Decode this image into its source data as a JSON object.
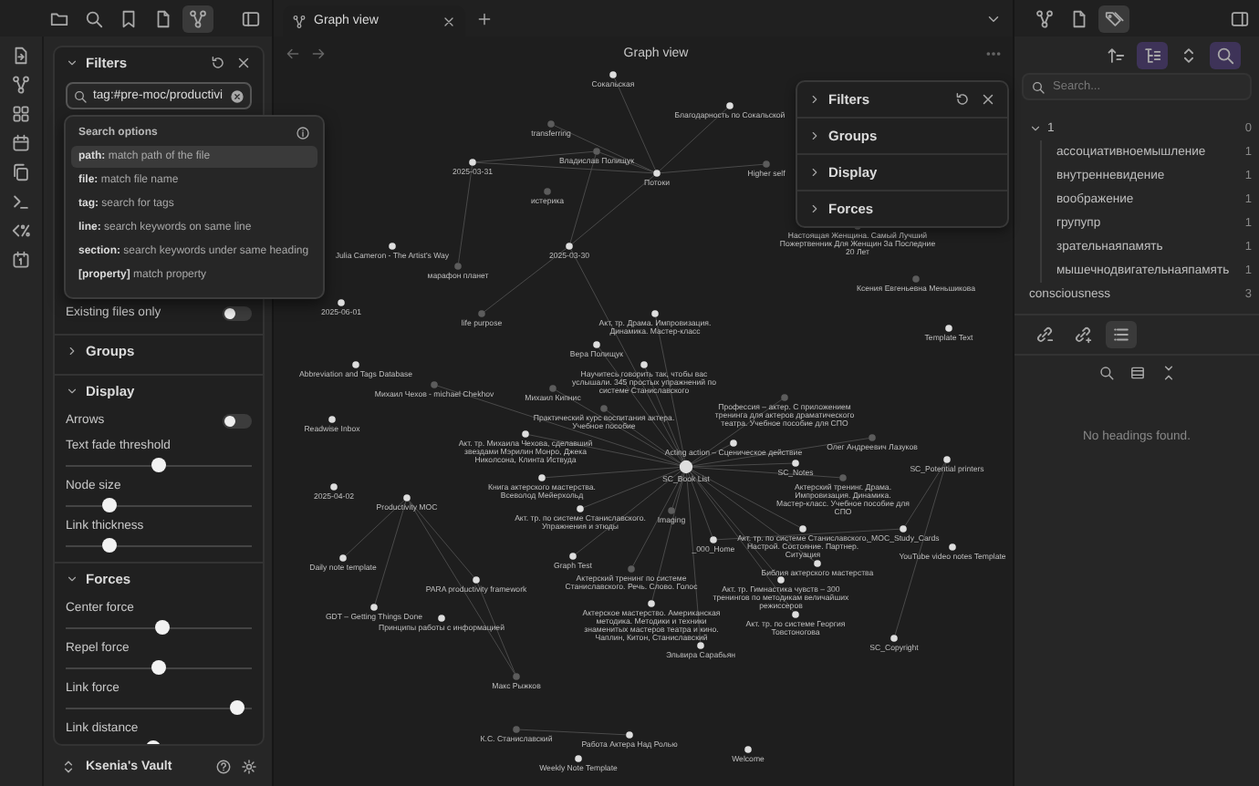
{
  "left_sidebar_tabs": [
    {
      "selected": false
    },
    {
      "selected": false
    },
    {
      "selected": false
    },
    {
      "selected": false
    },
    {
      "selected": true
    }
  ],
  "left_panel": {
    "sections": [
      {
        "title": "Filters",
        "expanded": true,
        "search": {
          "value": "tag:#pre-moc/productivi"
        },
        "controls": [
          {
            "kind": "toggle",
            "label": "Existing files only",
            "on": false
          }
        ]
      },
      {
        "title": "Groups",
        "expanded": false
      },
      {
        "title": "Display",
        "expanded": true,
        "controls": [
          {
            "kind": "toggle",
            "label": "Arrows",
            "on": false
          },
          {
            "kind": "slider",
            "label": "Text fade threshold",
            "level": 0.5
          },
          {
            "kind": "slider",
            "label": "Node size",
            "level": 0.21
          },
          {
            "kind": "slider",
            "label": "Link thickness",
            "level": 0.21
          }
        ]
      },
      {
        "title": "Forces",
        "expanded": true,
        "controls": [
          {
            "kind": "slider",
            "label": "Center force",
            "level": 0.52
          },
          {
            "kind": "slider",
            "label": "Repel force",
            "level": 0.5
          },
          {
            "kind": "slider",
            "label": "Link force",
            "level": 0.96
          },
          {
            "kind": "slider",
            "label": "Link distance",
            "level": 0.47
          }
        ]
      }
    ]
  },
  "search_options": {
    "title": "Search options",
    "items": [
      {
        "text": "**path:** match path of the file",
        "selected": true
      },
      {
        "text": "**file:** match file name",
        "selected": false
      },
      {
        "text": "**tag:** search for tags",
        "selected": false
      },
      {
        "text": "**line:** search keywords on same line",
        "selected": false
      },
      {
        "text": "**section:** search keywords under same heading",
        "selected": false
      },
      {
        "text": "**[property]** match property",
        "selected": false
      }
    ]
  },
  "vault": {
    "name": "Ksenia's Vault"
  },
  "tabs": [
    {
      "label": "Graph view",
      "selected": true
    }
  ],
  "graph_view": {
    "title": "Graph view",
    "nodes": [
      {
        "label": "Сокальская",
        "dim": false
      },
      {
        "label": "Благодарность по Сокальской",
        "dim": false
      },
      {
        "label": "transferring",
        "dim": true
      },
      {
        "label": "Владислав Полищук",
        "dim": true
      },
      {
        "label": "2025-03-31",
        "dim": false
      },
      {
        "label": "Потоки",
        "dim": false
      },
      {
        "label": "Higher self",
        "dim": true
      },
      {
        "label": "истерика",
        "dim": true
      },
      {
        "label": "Настоящая Женщина. Самый Лучший Пожертвенник Для Женщин За Последние 20 Лет",
        "dim": true
      },
      {
        "label": "Ксения Евгеньевна Меньшикова",
        "dim": true
      },
      {
        "label": "Julia Cameron - The Artist's Way",
        "dim": false
      },
      {
        "label": "марафон планет",
        "dim": true
      },
      {
        "label": "2025-03-30",
        "dim": false
      },
      {
        "label": "2025-06-01",
        "dim": false
      },
      {
        "label": "life purpose",
        "dim": true
      },
      {
        "label": "Template Text",
        "dim": false
      },
      {
        "label": "Abbreviation and Tags Database",
        "dim": false
      },
      {
        "label": "Акт. тр. Драма. Импровизация. Динамика. Мастер-класс",
        "dim": false
      },
      {
        "label": "Вера Полищук",
        "dim": false
      },
      {
        "label": "Научитесь говорить так, чтобы вас услышали. 345 простых упражнений по системе Станиславского",
        "dim": false
      },
      {
        "label": "Михаил Кипнис",
        "dim": true
      },
      {
        "label": "Михаил Чехов - michael Chekhov",
        "dim": true
      },
      {
        "label": "Практический курс воспитания актера. Учебное пособие",
        "dim": true
      },
      {
        "label": "Профессия – актер. С приложением тренинга для актеров драматического театра. Учебное пособие для СПО",
        "dim": true
      },
      {
        "label": "Readwise Inbox",
        "dim": false
      },
      {
        "label": "Акт. тр. Михаила Чехова, сделавший звездами Мэрилин Монро, Джека Николсона, Клинта Иствуда",
        "dim": false
      },
      {
        "label": "Олег Андреевич Лазуков",
        "dim": true
      },
      {
        "label": "Acting action – Сценическое действие",
        "dim": false
      },
      {
        "label": "SC_Notes",
        "dim": false
      },
      {
        "label": "SC_Book List",
        "dim": false
      },
      {
        "label": "SC_Potential printers",
        "dim": false
      },
      {
        "label": "2025-04-02",
        "dim": false
      },
      {
        "label": "Книга актерского мастерства. Всеволод Мейерхольд",
        "dim": false
      },
      {
        "label": "Productivity MOC",
        "dim": false
      },
      {
        "label": "Акт. тр. по системе Станиславского. Упражнения и этюды",
        "dim": false
      },
      {
        "label": "Imaging",
        "dim": true
      },
      {
        "label": "Актерский тренинг. Драма. Импровизация. Динамика. Мастер-класс. Учебное пособие для СПО",
        "dim": true
      },
      {
        "label": "Акт. тр. по системе Станиславского. Настрой. Состояние. Партнер. Ситуация",
        "dim": false
      },
      {
        "label": "_MOC_Study_Cards",
        "dim": false
      },
      {
        "label": "_000_Home",
        "dim": false
      },
      {
        "label": "YouTube video notes Template",
        "dim": false
      },
      {
        "label": "Daily note template",
        "dim": false
      },
      {
        "label": "Graph Test",
        "dim": false
      },
      {
        "label": "Библия актерского мастерства",
        "dim": false
      },
      {
        "label": "Акт. тр. Гимнастика чувств – 300 тренингов по методикам величайших режиссеров",
        "dim": false
      },
      {
        "label": "Актерский тренинг по системе Станиславского. Речь. Слово. Голос",
        "dim": true
      },
      {
        "label": "PARA productivity framework",
        "dim": false
      },
      {
        "label": "GDT – Getting Things Done",
        "dim": false
      },
      {
        "label": "Принципы работы с информацией",
        "dim": false
      },
      {
        "label": "Актерское мастерство. Американская методика. Методики и техники знаменитых мастеров театра и кино. Чаплин, Китон, Станиславский",
        "dim": false
      },
      {
        "label": "Акт. тр. по системе Георгия Товстоногова",
        "dim": false
      },
      {
        "label": "Эльвира Сарабьян",
        "dim": false
      },
      {
        "label": "SC_Copyright",
        "dim": false
      },
      {
        "label": "Макс Рыжков",
        "dim": true
      },
      {
        "label": "К.С. Станиславский",
        "dim": true
      },
      {
        "label": "Работа Актера Над Ролью",
        "dim": false
      },
      {
        "label": "Weekly Note Template",
        "dim": false
      },
      {
        "label": "Welcome",
        "dim": false
      }
    ],
    "overlay": {
      "sections": [
        {
          "title": "Filters",
          "expanded": false
        },
        {
          "title": "Groups",
          "expanded": false
        },
        {
          "title": "Display",
          "expanded": false
        },
        {
          "title": "Forces",
          "expanded": false
        }
      ]
    }
  },
  "right_sidebar_tabs": [
    {
      "selected": false
    },
    {
      "selected": false
    },
    {
      "selected": true
    }
  ],
  "right_panel": {
    "toolbar": [
      {
        "selected": false
      },
      {
        "selected": true
      },
      {
        "selected": false
      },
      {
        "selected": true
      }
    ],
    "search": {
      "placeholder": "Search..."
    },
    "tags": [
      {
        "name": "1",
        "count": "0",
        "expanded": true,
        "children": [
          {
            "name": "ассоциативноемышление",
            "count": "1"
          },
          {
            "name": "внутренневидение",
            "count": "1"
          },
          {
            "name": "воображение",
            "count": "1"
          },
          {
            "name": "групупр",
            "count": "1"
          },
          {
            "name": "зрательнаяпамять",
            "count": "1"
          },
          {
            "name": "мышечнодвигательнаяпамять",
            "count": "1"
          }
        ]
      },
      {
        "name": "consciousness",
        "count": "3"
      }
    ],
    "view_tabs": [
      {
        "selected": false
      },
      {
        "selected": false
      },
      {
        "selected": true
      }
    ],
    "outline_message": "No headings found."
  }
}
